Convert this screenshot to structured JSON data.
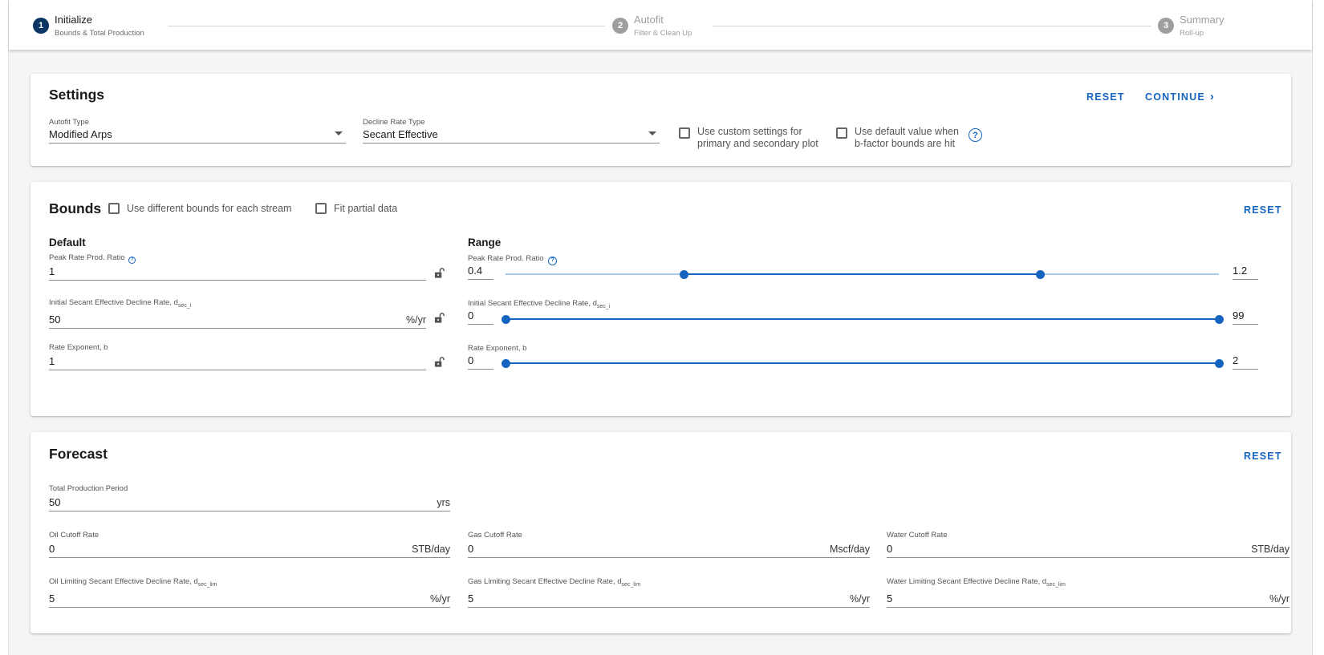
{
  "stepper": {
    "steps": [
      {
        "number": "1",
        "title": "Initialize",
        "subtitle": "Bounds & Total Production",
        "active": true
      },
      {
        "number": "2",
        "title": "Autofit",
        "subtitle": "Filter & Clean Up",
        "active": false
      },
      {
        "number": "3",
        "title": "Summary",
        "subtitle": "Roll-up",
        "active": false
      }
    ]
  },
  "settings": {
    "title": "Settings",
    "reset_label": "RESET",
    "continue_label": "CONTINUE",
    "autofit_type": {
      "label": "Autofit Type",
      "value": "Modified Arps"
    },
    "decline_rate_type": {
      "label": "Decline Rate Type",
      "value": "Secant Effective"
    },
    "custom_settings_line1": "Use custom settings for",
    "custom_settings_line2": "primary and secondary plot",
    "default_value_line1": "Use default value when",
    "default_value_line2": "b-factor bounds are hit",
    "help_glyph": "?"
  },
  "bounds": {
    "title": "Bounds",
    "diff_bounds_label": "Use different bounds for each stream",
    "fit_partial_label": "Fit partial data",
    "reset_label": "RESET",
    "default_head": "Default",
    "range_head": "Range",
    "help_glyph": "?",
    "peak_label": "Peak Rate Prod. Ratio",
    "peak_value": "1",
    "decline_label": "Initial Secant Effective Decline Rate, d",
    "decline_sub": "sec_i",
    "decline_value": "50",
    "decline_unit": "%/yr",
    "exponent_label": "Rate Exponent, b",
    "exponent_value": "1",
    "ranges": [
      {
        "min": 0.4,
        "max": 1.2,
        "low": 0.6,
        "high": 1.0,
        "min_label": "0.4",
        "max_label": "1.2"
      },
      {
        "min": 0,
        "max": 99,
        "low": 0,
        "high": 99,
        "min_label": "0",
        "max_label": "99"
      },
      {
        "min": 0,
        "max": 2,
        "low": 0,
        "high": 2,
        "min_label": "0",
        "max_label": "2"
      }
    ]
  },
  "forecast": {
    "title": "Forecast",
    "reset_label": "RESET",
    "total_period": {
      "label": "Total Production Period",
      "value": "50",
      "unit": "yrs"
    },
    "oil_cutoff": {
      "label": "Oil Cutoff Rate",
      "value": "0",
      "unit": "STB/day"
    },
    "gas_cutoff": {
      "label": "Gas Cutoff Rate",
      "value": "0",
      "unit": "Mscf/day"
    },
    "water_cutoff": {
      "label": "Water Cutoff Rate",
      "value": "0",
      "unit": "STB/day"
    },
    "oil_limit": {
      "label": "Oil Limiting Secant Effective Decline Rate, d",
      "value": "5",
      "unit": "%/yr"
    },
    "gas_limit": {
      "label": "Gas Limiting Secant Effective Decline Rate, d",
      "value": "5",
      "unit": "%/yr"
    },
    "water_limit": {
      "label": "Water Limiting Secant Effective Decline Rate, d",
      "value": "5",
      "unit": "%/yr"
    },
    "limit_sub": "sec_lim"
  },
  "colors": {
    "accent": "#1565c0",
    "active_step": "#0b3563",
    "inactive_step": "#9e9e9e"
  }
}
